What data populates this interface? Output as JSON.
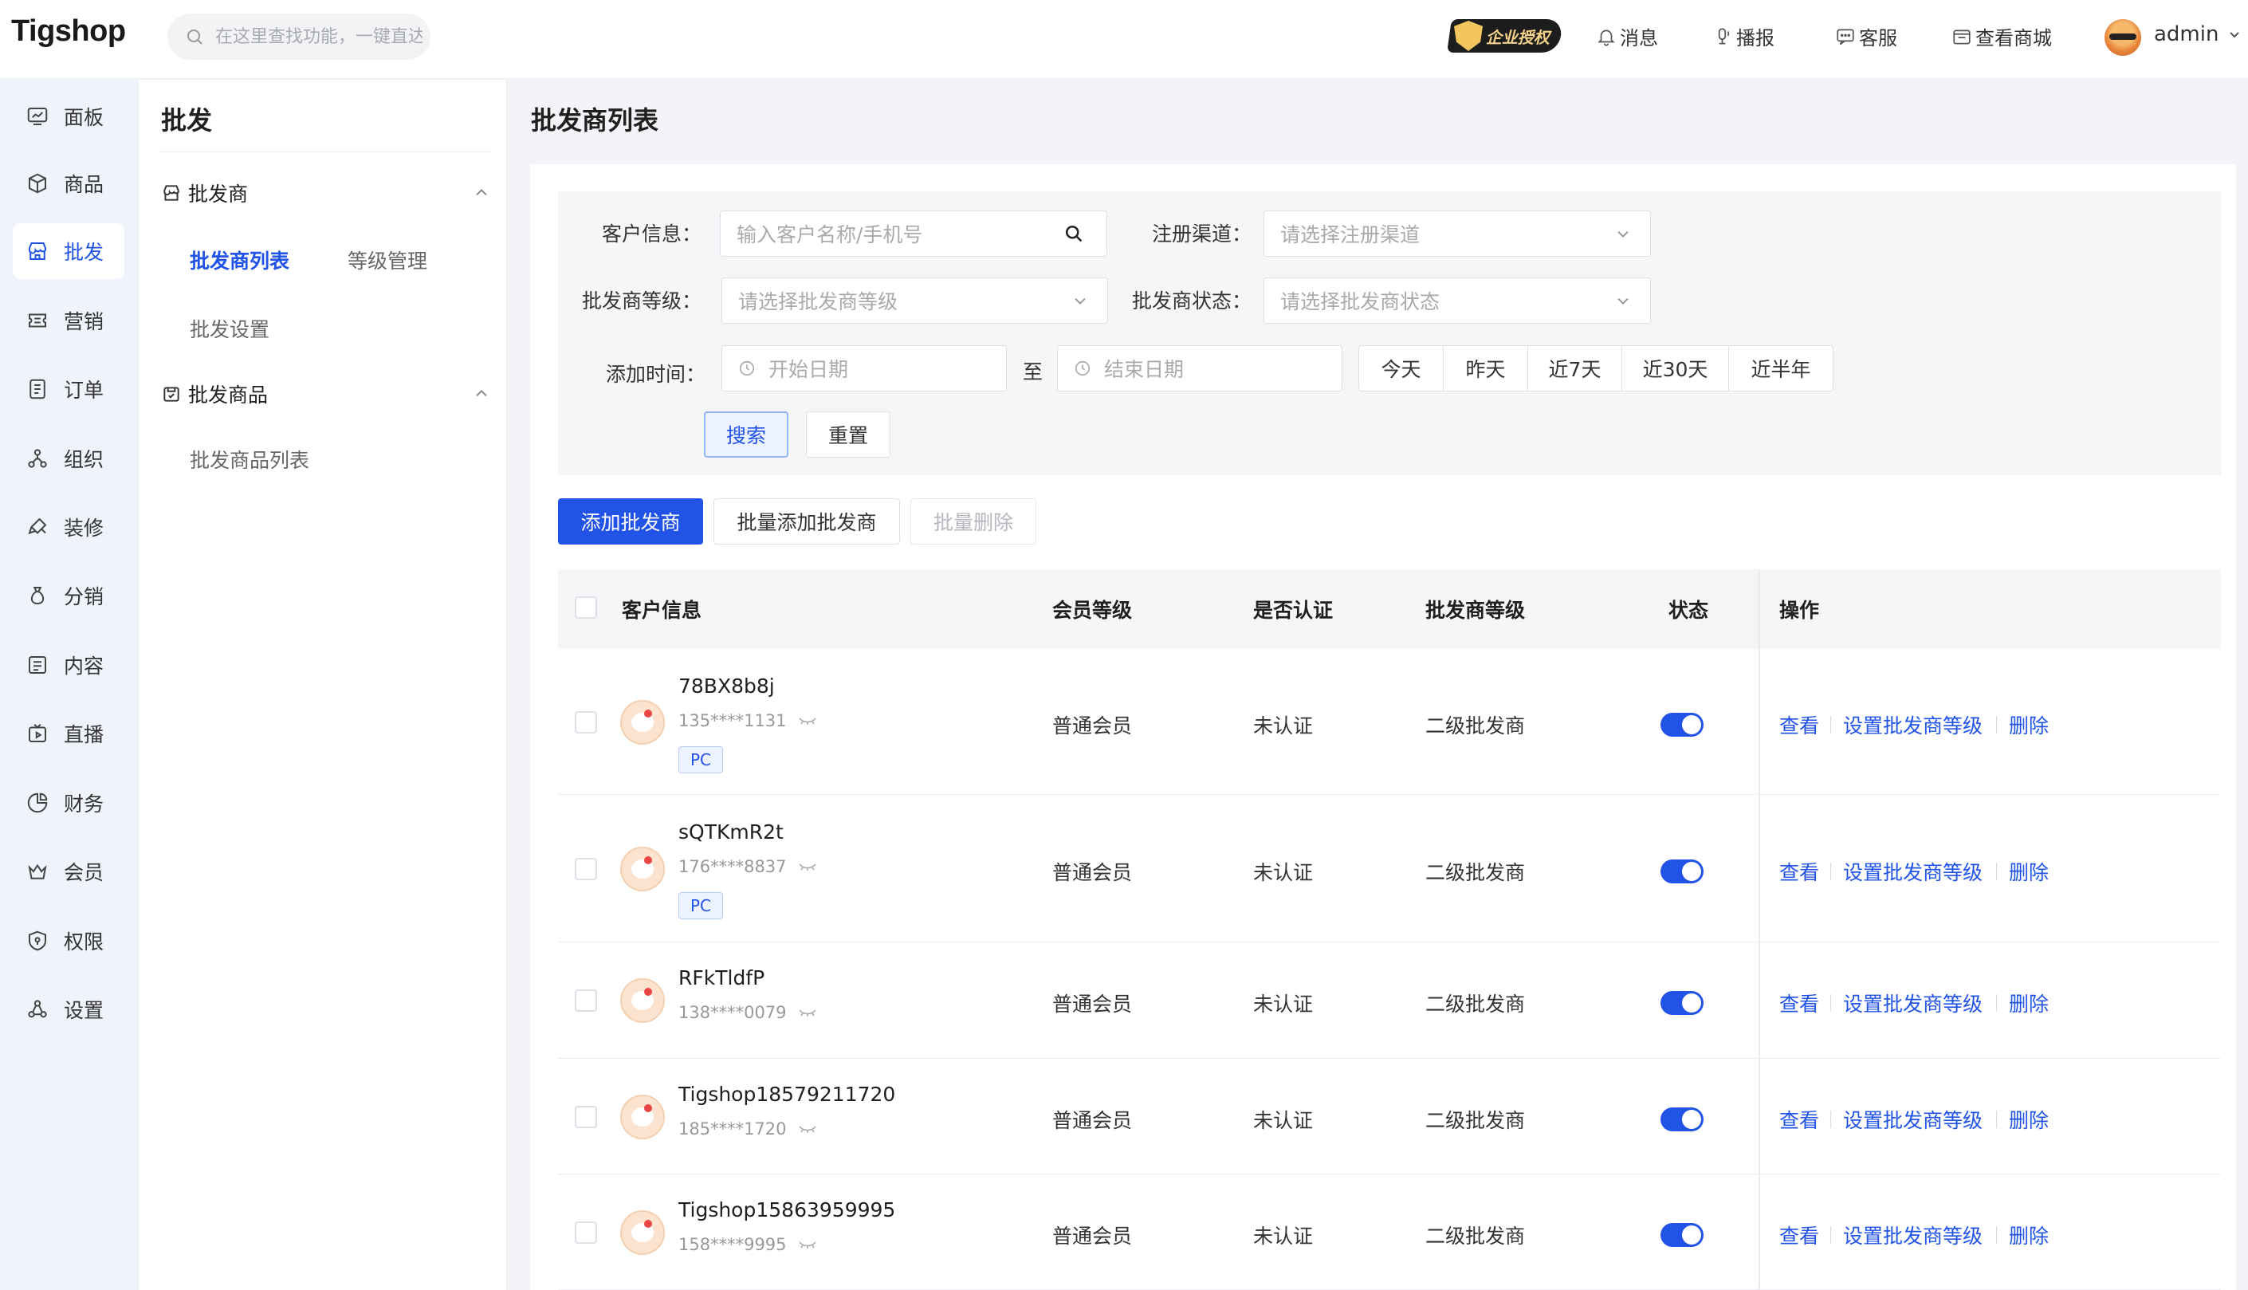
{
  "brand": "Tigshop",
  "search": {
    "placeholder": "在这里查找功能，一键直达"
  },
  "top_links": {
    "auth": "企业授权",
    "messages": "消息",
    "broadcast": "播报",
    "service": "客服",
    "view_store": "查看商城",
    "user": "admin"
  },
  "left_nav": [
    "面板",
    "商品",
    "批发",
    "营销",
    "订单",
    "组织",
    "装修",
    "分销",
    "内容",
    "直播",
    "财务",
    "会员",
    "权限",
    "设置"
  ],
  "sub_nav": {
    "title": "批发",
    "group1": "批发商",
    "group1_items": [
      "批发商列表",
      "等级管理",
      "批发设置"
    ],
    "group2": "批发商品",
    "group2_items": [
      "批发商品列表"
    ]
  },
  "page_title": "批发商列表",
  "filters": {
    "customer_label": "客户信息：",
    "customer_placeholder": "输入客户名称/手机号",
    "channel_label": "注册渠道：",
    "channel_placeholder": "请选择注册渠道",
    "level_label": "批发商等级：",
    "level_placeholder": "请选择批发商等级",
    "status_label": "批发商状态：",
    "status_placeholder": "请选择批发商状态",
    "time_label": "添加时间：",
    "start_placeholder": "开始日期",
    "to": "至",
    "end_placeholder": "结束日期",
    "quick": [
      "今天",
      "昨天",
      "近7天",
      "近30天",
      "近半年"
    ],
    "search": "搜索",
    "reset": "重置"
  },
  "actions": {
    "add": "添加批发商",
    "batch_add": "批量添加批发商",
    "batch_delete": "批量删除"
  },
  "table": {
    "headers": [
      "客户信息",
      "会员等级",
      "是否认证",
      "批发商等级",
      "状态",
      "操作"
    ],
    "ops": [
      "查看",
      "设置批发商等级",
      "删除"
    ],
    "rows": [
      {
        "name": "78BX8b8j",
        "phone": "135****1131",
        "tag": "PC",
        "member_level": "普通会员",
        "verified": "未认证",
        "level": "二级批发商",
        "enabled": true
      },
      {
        "name": "sQTKmR2t",
        "phone": "176****8837",
        "tag": "PC",
        "member_level": "普通会员",
        "verified": "未认证",
        "level": "二级批发商",
        "enabled": true
      },
      {
        "name": "RFkTldfP",
        "phone": "138****0079",
        "tag": "",
        "member_level": "普通会员",
        "verified": "未认证",
        "level": "二级批发商",
        "enabled": true
      },
      {
        "name": "Tigshop18579211720",
        "phone": "185****1720",
        "tag": "",
        "member_level": "普通会员",
        "verified": "未认证",
        "level": "二级批发商",
        "enabled": true
      },
      {
        "name": "Tigshop15863959995",
        "phone": "158****9995",
        "tag": "",
        "member_level": "普通会员",
        "verified": "未认证",
        "level": "二级批发商",
        "enabled": true
      }
    ]
  },
  "colors": {
    "primary": "#2154e6",
    "nav_bg": "#eff3fb",
    "filter_bg": "#f5f6f8"
  }
}
